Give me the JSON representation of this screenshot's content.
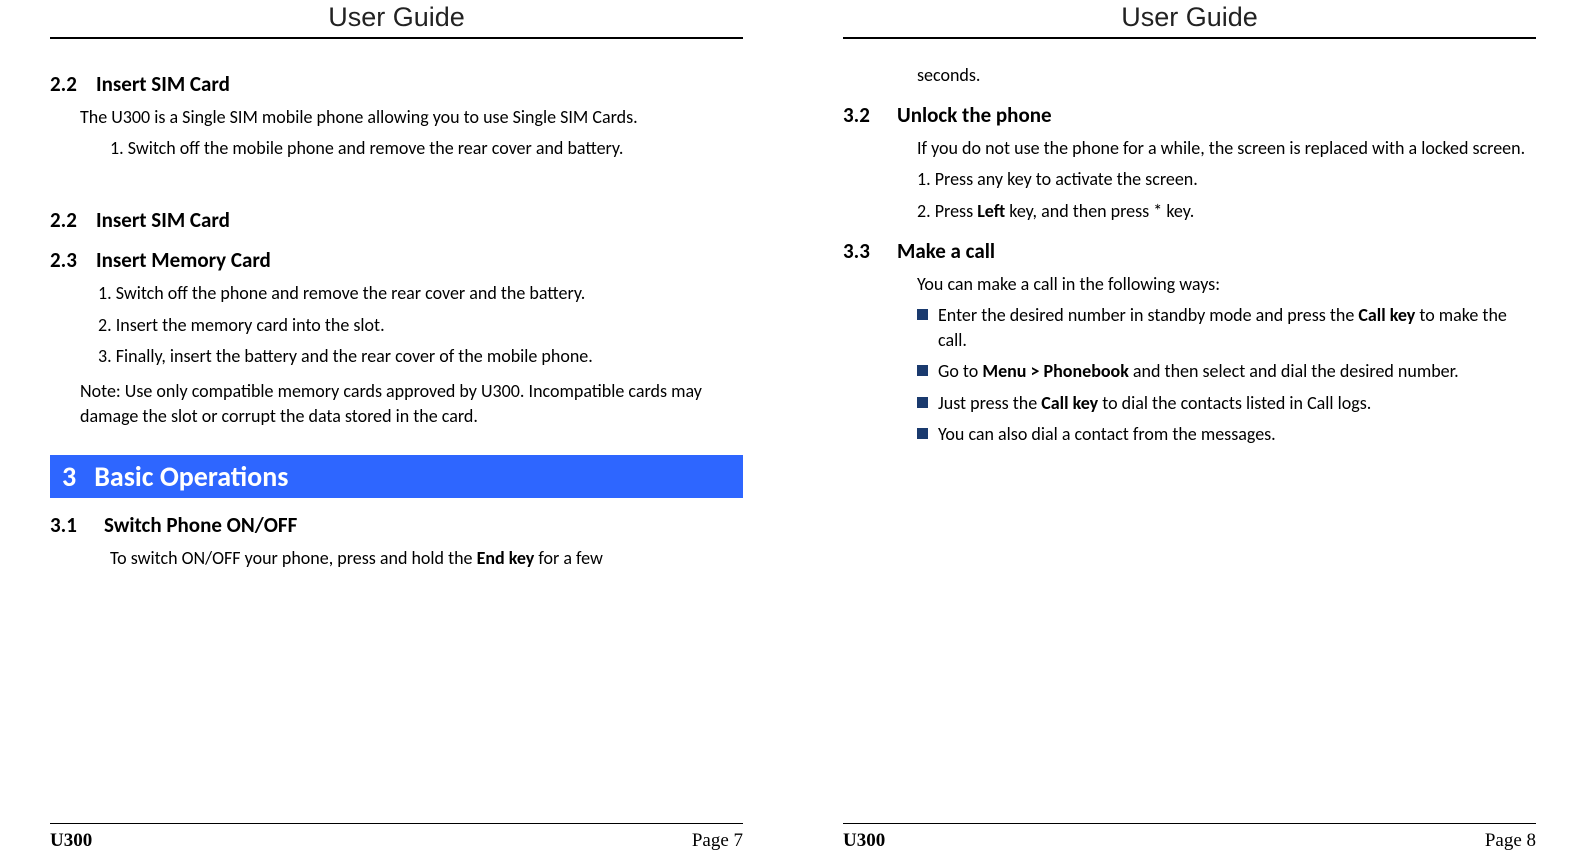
{
  "header": "User Guide",
  "model": "U300",
  "left": {
    "page_label": "Page 7",
    "s22a": {
      "num": "2.2",
      "title": "Insert SIM Card"
    },
    "s22a_p": "The U300 is a Single SIM mobile phone allowing you to use Single SIM Cards.",
    "s22a_li1": "1. Switch off the mobile phone and remove the rear cover and battery.",
    "s22b": {
      "num": "2.2",
      "title": "Insert SIM Card"
    },
    "s23": {
      "num": "2.3",
      "title": "Insert Memory Card"
    },
    "s23_li1": "1. Switch off the phone and remove the rear cover and the battery.",
    "s23_li2": "2. Insert the memory card into the slot.",
    "s23_li3": "3. Finally, insert the battery and the rear cover of the mobile phone.",
    "s23_note": "Note:  Use only compatible memory cards approved by U300. Incompatible cards may damage the slot or corrupt the data stored in the card.",
    "ch3": {
      "num": "3",
      "title": "Basic Operations"
    },
    "s31": {
      "num": "3.1",
      "title": "Switch Phone ON/OFF"
    },
    "s31_p_a": "To switch ON/OFF your phone, press and hold the ",
    "s31_p_b": "End key",
    "s31_p_c": " for a few"
  },
  "right": {
    "page_label": "Page 8",
    "cont": "seconds.",
    "s32": {
      "num": "3.2",
      "title": "Unlock the phone"
    },
    "s32_p": "If you do not use the phone for a while, the screen is replaced with a locked screen.",
    "s32_li1": "1. Press any key to activate the screen.",
    "s32_li2_a": "2. Press ",
    "s32_li2_b": "Left",
    "s32_li2_c": " key, and then press * key.",
    "s33": {
      "num": "3.3",
      "title": "Make a call"
    },
    "s33_p": "You can make a call in the following ways:",
    "b1_a": "Enter the desired number in standby mode and press the ",
    "b1_b": "Call key",
    "b1_c": " to make the call.",
    "b2_a": "Go to ",
    "b2_b": "Menu > Phonebook",
    "b2_c": " and then select and dial the desired number.",
    "b3_a": "Just press the ",
    "b3_b": "Call key",
    "b3_c": " to dial the contacts listed in Call logs.",
    "b4": "You can also dial a contact from the messages."
  }
}
